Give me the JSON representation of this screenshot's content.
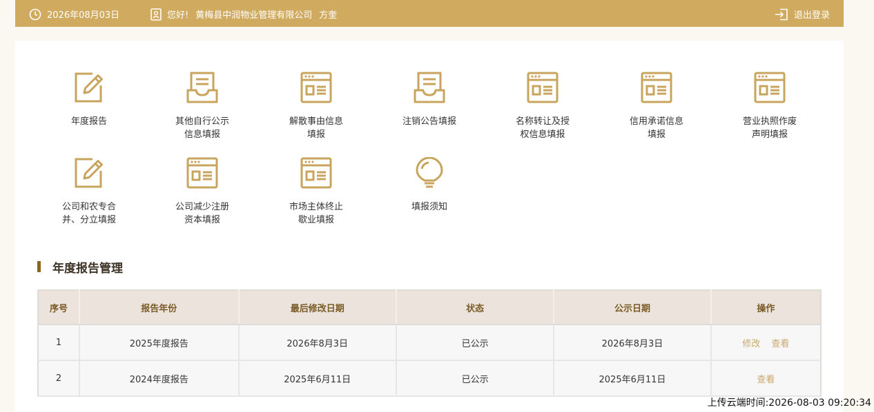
{
  "header": {
    "date": "2026年08月03日",
    "greeting": "您好!",
    "company": "黄梅县中润物业管理有限公司",
    "user": "方奎",
    "logout_label": "退出登录"
  },
  "tiles": [
    {
      "line1": "年度报告",
      "line2": "",
      "icon": "edit-icon"
    },
    {
      "line1": "其他自行公示",
      "line2": "信息填报",
      "icon": "document-tray-icon"
    },
    {
      "line1": "解散事由信息",
      "line2": "填报",
      "icon": "form-window-icon"
    },
    {
      "line1": "注销公告填报",
      "line2": "",
      "icon": "document-tray-icon"
    },
    {
      "line1": "名称转让及授",
      "line2": "权信息填报",
      "icon": "form-window-icon"
    },
    {
      "line1": "信用承诺信息",
      "line2": "填报",
      "icon": "form-window-icon"
    },
    {
      "line1": "营业执照作废",
      "line2": "声明填报",
      "icon": "form-window-icon"
    },
    {
      "line1": "公司和农专合",
      "line2": "并、分立填报",
      "icon": "edit-icon"
    },
    {
      "line1": "公司减少注册",
      "line2": "资本填报",
      "icon": "form-window-icon"
    },
    {
      "line1": "市场主体终止",
      "line2": "歇业填报",
      "icon": "form-window-icon"
    },
    {
      "line1": "填报须知",
      "line2": "",
      "icon": "lightbulb-icon"
    }
  ],
  "section": {
    "title": "年度报告管理"
  },
  "table": {
    "headers": [
      "序号",
      "报告年份",
      "最后修改日期",
      "状态",
      "公示日期",
      "操作"
    ],
    "rows": [
      {
        "no": "1",
        "year": "2025年度报告",
        "modified": "2026年8月3日",
        "status": "已公示",
        "publish": "2026年8月3日",
        "edit": "修改",
        "view": "查看"
      },
      {
        "no": "2",
        "year": "2024年度报告",
        "modified": "2025年6月11日",
        "status": "已公示",
        "publish": "2025年6月11日",
        "view": "查看"
      }
    ]
  },
  "footer": {
    "upload_time": "上传云端时间:2026-08-03 09:20:34"
  },
  "colors": {
    "brand": "#d0aa5e",
    "icon": "#c9a45c",
    "header_text": "#7a5a25",
    "action": "#c9a86a"
  }
}
